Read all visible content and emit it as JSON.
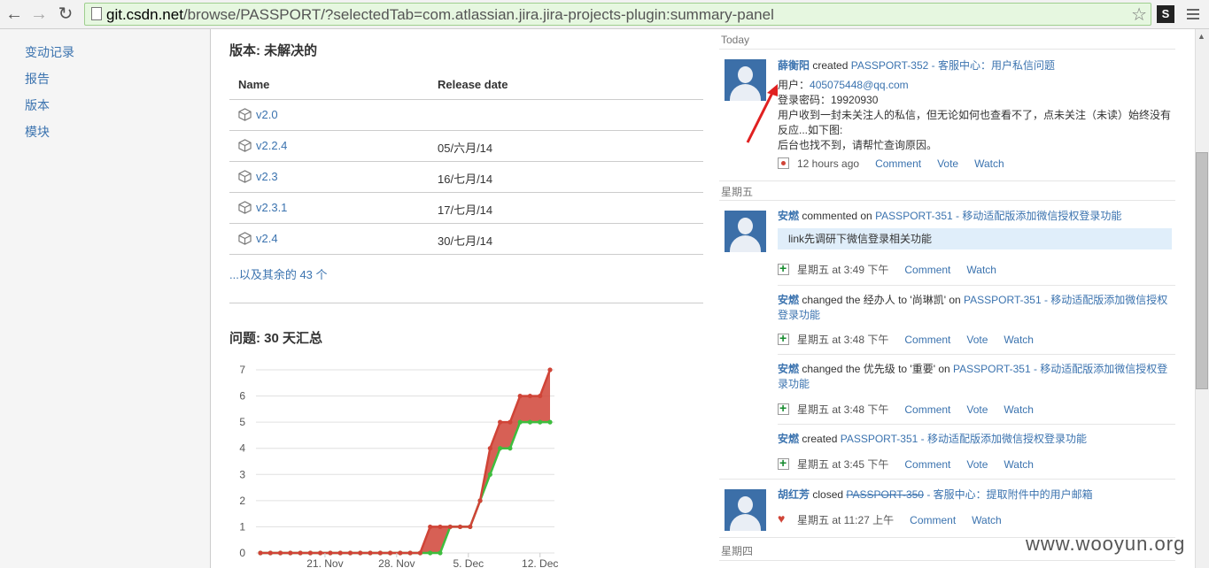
{
  "browser": {
    "url_host": "git.csdn.net",
    "url_path": "/browse/PASSPORT/?selectedTab=com.atlassian.jira.jira-projects-plugin:summary-panel",
    "extension_label": "S"
  },
  "sidebar": {
    "items": [
      "变动记录",
      "报告",
      "版本",
      "模块"
    ]
  },
  "versions": {
    "title": "版本: 未解决的",
    "col_name": "Name",
    "col_date": "Release date",
    "rows": [
      {
        "name": "v2.0",
        "date": ""
      },
      {
        "name": "v2.2.4",
        "date": "05/六月/14"
      },
      {
        "name": "v2.3",
        "date": "16/七月/14"
      },
      {
        "name": "v2.3.1",
        "date": "17/七月/14"
      },
      {
        "name": "v2.4",
        "date": "30/七月/14"
      }
    ],
    "more": "...以及其余的 43 个"
  },
  "issues": {
    "title": "问题: 30 天汇总"
  },
  "chart_data": {
    "type": "area",
    "title": "",
    "xlabel": "",
    "ylabel": "",
    "ylim": [
      0,
      7
    ],
    "yticks": [
      0,
      1,
      2,
      3,
      4,
      5,
      6,
      7
    ],
    "xtick_labels": [
      "21. Nov",
      "28. Nov",
      "5. Dec",
      "12. Dec"
    ],
    "grid": true,
    "series": [
      {
        "color": "#d04437",
        "values": [
          0,
          0,
          0,
          0,
          0,
          0,
          0,
          0,
          0,
          0,
          0,
          0,
          0,
          0,
          0,
          0,
          0,
          1,
          1,
          1,
          1,
          1,
          2,
          4,
          5,
          5,
          6,
          6,
          6,
          7
        ]
      },
      {
        "color": "#3ebd3e",
        "values": [
          0,
          0,
          0,
          0,
          0,
          0,
          0,
          0,
          0,
          0,
          0,
          0,
          0,
          0,
          0,
          0,
          0,
          0,
          0,
          1,
          1,
          1,
          2,
          3,
          4,
          4,
          5,
          5,
          5,
          5
        ]
      }
    ]
  },
  "activity": {
    "today_label": "Today",
    "friday_label": "星期五",
    "thursday_label": "星期四",
    "items": [
      {
        "user": "薛衡阳",
        "verb": " created ",
        "issue": "PASSPORT-352 - 客服中心：用户私信问题",
        "body_line1_prefix": "用户：",
        "body_line1_link": "405075448@qq.com",
        "body_line2": "登录密码：19920930",
        "body_line3": "用户收到一封未关注人的私信，但无论如何也查看不了，点未关注（未读）始终没有反应...如下图:",
        "body_line4": "后台也找不到，请帮忙查询原因。",
        "time": "12 hours ago",
        "comment": "Comment",
        "vote": "Vote",
        "watch": "Watch"
      },
      {
        "user": "安燃",
        "verb": " commented on ",
        "issue": "PASSPORT-351 - 移动适配版添加微信授权登录功能",
        "comment_text": "link先调研下微信登录相关功能",
        "time": "星期五 at 3:49 下午",
        "comment": "Comment",
        "watch": "Watch"
      },
      {
        "user": "安燃",
        "verb": " changed the 经办人 to '尚琳凯' on ",
        "issue": "PASSPORT-351 - 移动适配版添加微信授权登录功能",
        "time": "星期五 at 3:48 下午",
        "comment": "Comment",
        "vote": "Vote",
        "watch": "Watch"
      },
      {
        "user": "安燃",
        "verb": " changed the 优先级 to '重要' on ",
        "issue": "PASSPORT-351 - 移动适配版添加微信授权登录功能",
        "time": "星期五 at 3:48 下午",
        "comment": "Comment",
        "vote": "Vote",
        "watch": "Watch"
      },
      {
        "user": "安燃",
        "verb": " created ",
        "issue": "PASSPORT-351 - 移动适配版添加微信授权登录功能",
        "time": "星期五 at 3:45 下午",
        "comment": "Comment",
        "vote": "Vote",
        "watch": "Watch"
      },
      {
        "user": "胡红芳",
        "verb": " closed ",
        "issue_struck": "PASSPORT-350",
        "issue_rest": " - 客服中心：提取附件中的用户邮箱",
        "time": "星期五 at 11:27 上午",
        "comment": "Comment",
        "watch": "Watch"
      }
    ]
  },
  "watermark": "www.wooyun.org"
}
